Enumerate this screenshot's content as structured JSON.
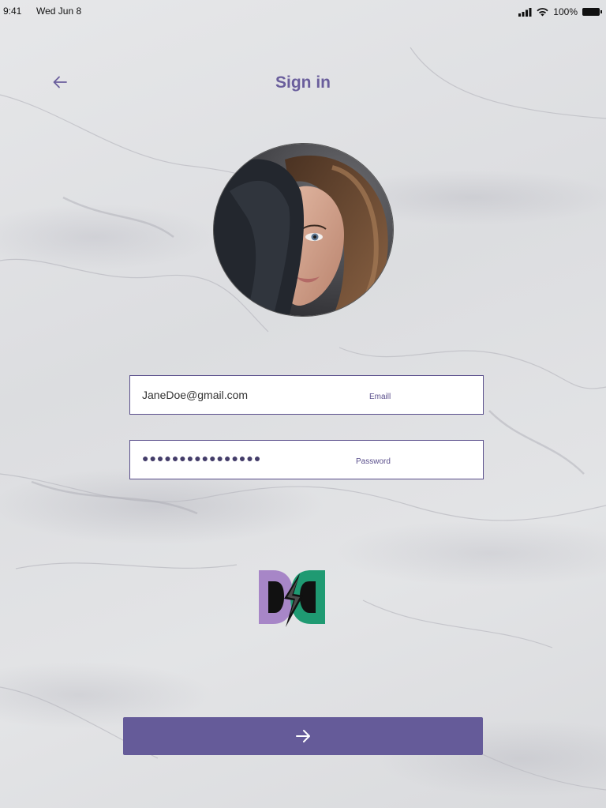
{
  "status_bar": {
    "time": "9:41",
    "date": "Wed Jun 8",
    "battery_percent": "100%",
    "signal_icon": "cellular-signal-icon",
    "wifi_icon": "wifi-icon",
    "battery_icon": "battery-icon"
  },
  "header": {
    "title": "Sign in",
    "back_icon": "arrow-left-icon"
  },
  "form": {
    "email": {
      "value": "JaneDoe@gmail.com",
      "label": "Emaill"
    },
    "password": {
      "value": "●●●●●●●●●●●●●●●●",
      "label": "Password"
    }
  },
  "submit": {
    "icon": "arrow-right-icon"
  },
  "colors": {
    "accent": "#655b99",
    "title": "#6a5e9c",
    "logo_purple": "#a786c7",
    "logo_green": "#1f9a72"
  }
}
